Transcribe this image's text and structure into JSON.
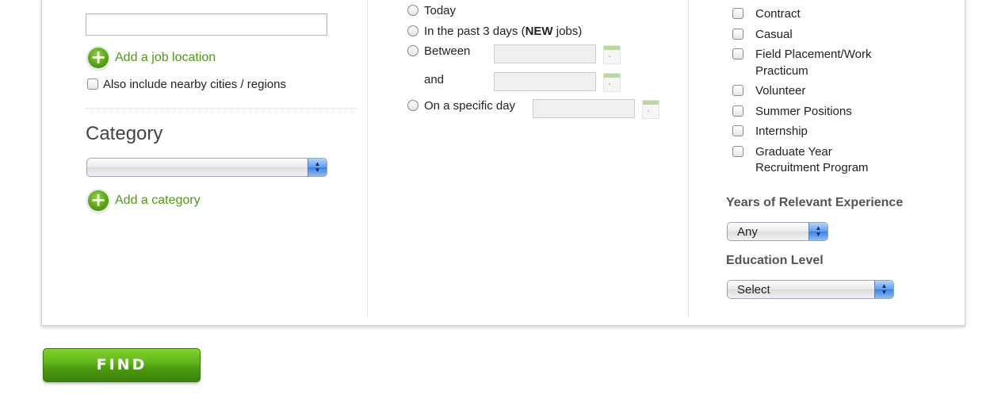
{
  "location": {
    "input_value": "",
    "add_label": "Add a job location",
    "nearby_label": "Also include nearby cities / regions"
  },
  "category": {
    "heading": "Category",
    "select_value": "",
    "add_label": "Add a category"
  },
  "date_posted": {
    "today": "Today",
    "past3_prefix": "In the past 3 days (",
    "past3_new": "NEW",
    "past3_suffix": " jobs)",
    "between": "Between",
    "and": "and",
    "specific_day": "On a specific day"
  },
  "job_types": [
    {
      "label": "Contract"
    },
    {
      "label": "Casual"
    },
    {
      "label": "Field Placement/Work",
      "label2": "Practicum"
    },
    {
      "label": "Volunteer"
    },
    {
      "label": "Summer Positions"
    },
    {
      "label": "Internship"
    },
    {
      "label": "Graduate Year",
      "label2": "Recruitment Program"
    }
  ],
  "experience": {
    "heading": "Years of Relevant Experience",
    "value": "Any"
  },
  "education": {
    "heading": "Education Level",
    "value": "Select"
  },
  "find_button": "FIND",
  "colors": {
    "accent_green": "#4f9a12",
    "select_blue": "#3a82e4"
  }
}
